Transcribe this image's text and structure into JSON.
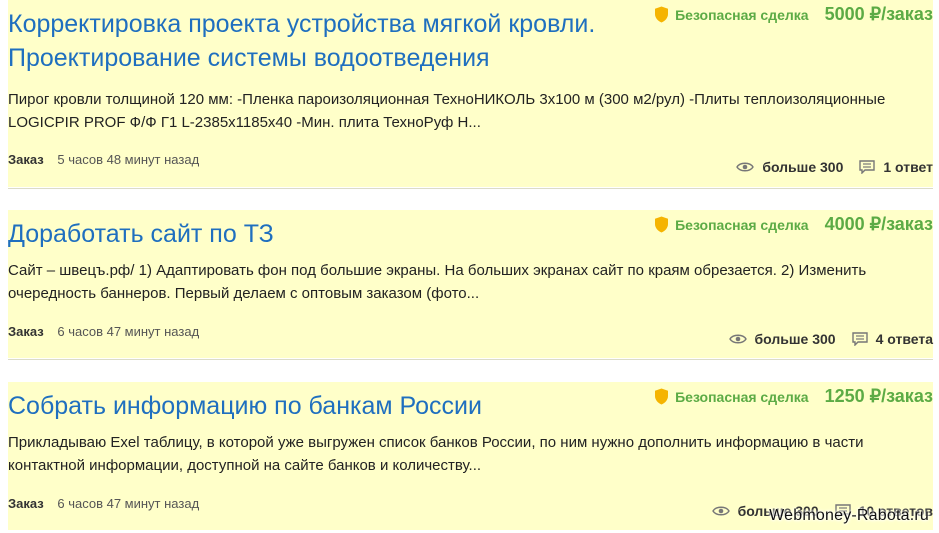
{
  "colors": {
    "card_background": "#ffffc9",
    "title_link": "#1f6fbf",
    "accent_green": "#5cab45",
    "shield_orange": "#f5b400"
  },
  "orders": [
    {
      "title": "Корректировка проекта устройства мягкой кровли. Проектирование системы водоотведения",
      "safe_deal_label": "Безопасная сделка",
      "price": "5000 ₽/заказ",
      "description": "Пирог кровли толщиной 120 мм: -Пленка пароизоляционная ТехноНИКОЛЬ 3х100 м (300 м2/рул) -Плиты теплоизоляционные LOGICPIR PROF Ф/Ф Г1 L-2385x1185x40 -Мин. плита ТехноРуф Н...",
      "type": "Заказ",
      "posted": "5 часов 48 минут назад",
      "views": "больше 300",
      "responses": "1 ответ"
    },
    {
      "title": "Доработать сайт по ТЗ",
      "safe_deal_label": "Безопасная сделка",
      "price": "4000 ₽/заказ",
      "description": "Сайт – швецъ.рф/ 1) Адаптировать фон под большие экраны. На больших экранах сайт по краям обрезается. 2) Изменить очередность баннеров. Первый делаем с оптовым заказом (фото...",
      "type": "Заказ",
      "posted": "6 часов 47 минут назад",
      "views": "больше 300",
      "responses": "4 ответа"
    },
    {
      "title": "Собрать информацию по банкам России",
      "safe_deal_label": "Безопасная сделка",
      "price": "1250 ₽/заказ",
      "description": "Прикладываю Exel таблицу, в которой уже выгружен список банков России, по ним нужно дополнить информацию в части контактной информации, доступной на сайте банков и количеству...",
      "type": "Заказ",
      "posted": "6 часов 47 минут назад",
      "views": "больше 300",
      "responses": "10 ответов"
    }
  ],
  "icons": {
    "safe_deal": "shield-icon",
    "views": "eye-icon",
    "responses": "comment-icon"
  },
  "watermark": "Webmoney-Rabota.ru"
}
